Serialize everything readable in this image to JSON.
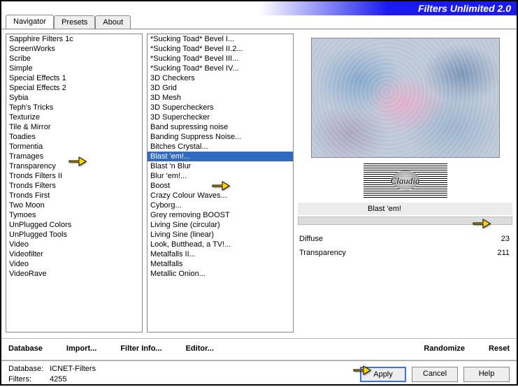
{
  "app_title": "Filters Unlimited 2.0",
  "tabs": {
    "navigator": "Navigator",
    "presets": "Presets",
    "about": "About"
  },
  "categories": [
    "Sapphire Filters 1c",
    "ScreenWorks",
    "Scribe",
    "Simple",
    "Special Effects 1",
    "Special Effects 2",
    "Sybia",
    "Teph's Tricks",
    "Texturize",
    "Tile & Mirror",
    "Toadies",
    "Tormentia",
    "Tramages",
    "Transparency",
    "Tronds Filters II",
    "Tronds Filters",
    "Tronds First",
    "Two Moon",
    "Tymoes",
    "UnPlugged Colors",
    "UnPlugged Tools",
    "Video",
    "Videofilter",
    "Video",
    "VideoRave"
  ],
  "category_selected": "Toadies",
  "filters": [
    "*Sucking Toad*  Bevel I...",
    "*Sucking Toad*  Bevel II.2...",
    "*Sucking Toad*  Bevel III...",
    "*Sucking Toad*  Bevel IV...",
    "3D Checkers",
    "3D Grid",
    "3D Mesh",
    "3D Supercheckers",
    "3D Superchecker",
    "Band supressing noise",
    "Banding Suppress Noise...",
    "Bitches Crystal...",
    "Blast 'em!...",
    "Blast 'n Blur",
    "Blur 'em!...",
    "Boost",
    "Crazy Colour Waves...",
    "Cyborg...",
    "Grey removing BOOST",
    "Living Sine (circular)",
    "Living Sine (linear)",
    "Look, Butthead, a TV!...",
    "Metalfalls II...",
    "Metalfalls",
    "Metallic Onion..."
  ],
  "filter_selected": "Blast 'em!...",
  "watermark": "Claudia",
  "current_filter_name": "Blast 'em!",
  "params": [
    {
      "name": "Diffuse",
      "value": 23
    },
    {
      "name": "Transparency",
      "value": 211
    }
  ],
  "buttons_row1": {
    "database": "Database",
    "import": "Import...",
    "filterinfo": "Filter Info...",
    "editor": "Editor...",
    "randomize": "Randomize",
    "reset": "Reset"
  },
  "status": {
    "db_label": "Database:",
    "db_value": "ICNET-Filters",
    "filters_label": "Filters:",
    "filters_value": "4255"
  },
  "buttons_main": {
    "apply": "Apply",
    "cancel": "Cancel",
    "help": "Help"
  }
}
